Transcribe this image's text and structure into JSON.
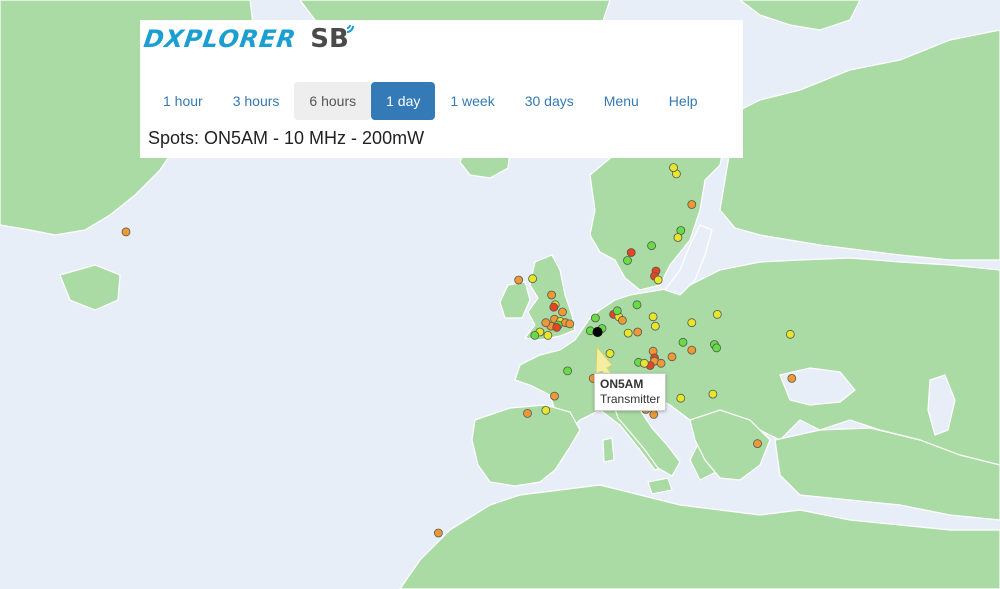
{
  "header": {
    "logo_text": "DXPLORER",
    "logo_mark": "SB",
    "title": "Spots: ON5AM - 10 MHz - 200mW"
  },
  "nav": [
    {
      "label": "1 hour",
      "state": "normal"
    },
    {
      "label": "3 hours",
      "state": "normal"
    },
    {
      "label": "6 hours",
      "state": "highlight"
    },
    {
      "label": "1 day",
      "state": "active"
    },
    {
      "label": "1 week",
      "state": "normal"
    },
    {
      "label": "30 days",
      "state": "normal"
    },
    {
      "label": "Menu",
      "state": "normal"
    },
    {
      "label": "Help",
      "state": "normal"
    }
  ],
  "transmitter": {
    "callsign": "ON5AM",
    "role": "Transmitter",
    "lat": 50.7,
    "lon": 4.6
  },
  "colors": {
    "sea": "#e8eef8",
    "land": "#aadba4",
    "border": "#ffffff",
    "accent": "#337ab7",
    "spot_green": "#66dd44",
    "spot_yellow": "#e6e62a",
    "spot_orange": "#ee9933",
    "spot_red": "#e84422",
    "arrow": "#f4eea0"
  },
  "spots": [
    {
      "lat": 58.6,
      "lon": -60.0,
      "color": "orange"
    },
    {
      "lat": 55.0,
      "lon": -6.2,
      "color": "orange"
    },
    {
      "lat": 55.1,
      "lon": -4.3,
      "color": "yellow"
    },
    {
      "lat": 53.8,
      "lon": -1.7,
      "color": "orange"
    },
    {
      "lat": 53.0,
      "lon": -1.2,
      "color": "yellow"
    },
    {
      "lat": 52.8,
      "lon": -1.4,
      "color": "red"
    },
    {
      "lat": 52.4,
      "lon": -0.2,
      "color": "orange"
    },
    {
      "lat": 51.8,
      "lon": -1.3,
      "color": "orange"
    },
    {
      "lat": 51.6,
      "lon": -0.5,
      "color": "yellow"
    },
    {
      "lat": 51.5,
      "lon": 0.2,
      "color": "orange"
    },
    {
      "lat": 51.3,
      "lon": -0.8,
      "color": "green"
    },
    {
      "lat": 51.2,
      "lon": -1.8,
      "color": "orange"
    },
    {
      "lat": 51.1,
      "lon": -1.0,
      "color": "red"
    },
    {
      "lat": 51.4,
      "lon": 0.8,
      "color": "orange"
    },
    {
      "lat": 50.7,
      "lon": -3.3,
      "color": "yellow"
    },
    {
      "lat": 50.4,
      "lon": -4.0,
      "color": "green"
    },
    {
      "lat": 50.4,
      "lon": -2.2,
      "color": "yellow"
    },
    {
      "lat": 51.5,
      "lon": -2.5,
      "color": "orange"
    },
    {
      "lat": 51.9,
      "lon": 4.3,
      "color": "green"
    },
    {
      "lat": 50.8,
      "lon": 3.6,
      "color": "green"
    },
    {
      "lat": 52.2,
      "lon": 6.8,
      "color": "red"
    },
    {
      "lat": 52.0,
      "lon": 7.5,
      "color": "yellow"
    },
    {
      "lat": 51.7,
      "lon": 8.0,
      "color": "orange"
    },
    {
      "lat": 52.5,
      "lon": 7.3,
      "color": "green"
    },
    {
      "lat": 53.0,
      "lon": 10.0,
      "color": "green"
    },
    {
      "lat": 52.0,
      "lon": 12.2,
      "color": "yellow"
    },
    {
      "lat": 51.2,
      "lon": 12.5,
      "color": "yellow"
    },
    {
      "lat": 51.5,
      "lon": 17.5,
      "color": "yellow"
    },
    {
      "lat": 52.2,
      "lon": 21.0,
      "color": "yellow"
    },
    {
      "lat": 50.7,
      "lon": 10.1,
      "color": "orange"
    },
    {
      "lat": 50.6,
      "lon": 8.8,
      "color": "yellow"
    },
    {
      "lat": 49.6,
      "lon": 20.6,
      "color": "green"
    },
    {
      "lat": 49.3,
      "lon": 20.9,
      "color": "green"
    },
    {
      "lat": 49.8,
      "lon": 16.3,
      "color": "green"
    },
    {
      "lat": 49.1,
      "lon": 17.5,
      "color": "orange"
    },
    {
      "lat": 48.5,
      "lon": 14.8,
      "color": "orange"
    },
    {
      "lat": 49.0,
      "lon": 12.2,
      "color": "orange"
    },
    {
      "lat": 48.4,
      "lon": 12.4,
      "color": "red"
    },
    {
      "lat": 48.1,
      "lon": 12.4,
      "color": "orange"
    },
    {
      "lat": 47.7,
      "lon": 11.8,
      "color": "red"
    },
    {
      "lat": 47.9,
      "lon": 13.3,
      "color": "orange"
    },
    {
      "lat": 48.0,
      "lon": 10.2,
      "color": "green"
    },
    {
      "lat": 47.9,
      "lon": 11.0,
      "color": "yellow"
    },
    {
      "lat": 48.8,
      "lon": 6.3,
      "color": "yellow"
    },
    {
      "lat": 51.0,
      "lon": 5.2,
      "color": "green"
    },
    {
      "lat": 56.5,
      "lon": 8.7,
      "color": "green"
    },
    {
      "lat": 57.1,
      "lon": 9.2,
      "color": "red"
    },
    {
      "lat": 57.6,
      "lon": 12.0,
      "color": "green"
    },
    {
      "lat": 55.7,
      "lon": 12.6,
      "color": "red"
    },
    {
      "lat": 55.3,
      "lon": 12.4,
      "color": "red"
    },
    {
      "lat": 55.0,
      "lon": 12.9,
      "color": "yellow"
    },
    {
      "lat": 58.7,
      "lon": 16.0,
      "color": "green"
    },
    {
      "lat": 58.2,
      "lon": 15.6,
      "color": "yellow"
    },
    {
      "lat": 62.5,
      "lon": 15.4,
      "color": "yellow"
    },
    {
      "lat": 60.5,
      "lon": 17.5,
      "color": "orange"
    },
    {
      "lat": 65.3,
      "lon": 14.5,
      "color": "green"
    },
    {
      "lat": 65.4,
      "lon": 21.2,
      "color": "orange"
    },
    {
      "lat": 62.9,
      "lon": 15.0,
      "color": "yellow"
    },
    {
      "lat": 47.2,
      "lon": 0.5,
      "color": "green"
    },
    {
      "lat": 45.5,
      "lon": 5.3,
      "color": "orange"
    },
    {
      "lat": 46.5,
      "lon": 4.0,
      "color": "orange"
    },
    {
      "lat": 44.8,
      "lon": -1.3,
      "color": "orange"
    },
    {
      "lat": 43.4,
      "lon": -2.5,
      "color": "yellow"
    },
    {
      "lat": 43.1,
      "lon": -5.0,
      "color": "orange"
    },
    {
      "lat": 44.6,
      "lon": 9.3,
      "color": "orange"
    },
    {
      "lat": 43.5,
      "lon": 11.2,
      "color": "orange"
    },
    {
      "lat": 43.0,
      "lon": 12.3,
      "color": "orange"
    },
    {
      "lat": 44.6,
      "lon": 16.0,
      "color": "yellow"
    },
    {
      "lat": 45.0,
      "lon": 20.4,
      "color": "yellow"
    },
    {
      "lat": 40.0,
      "lon": 26.5,
      "color": "orange"
    },
    {
      "lat": 50.5,
      "lon": 31.0,
      "color": "yellow"
    },
    {
      "lat": 46.5,
      "lon": 31.2,
      "color": "orange"
    },
    {
      "lat": 30.0,
      "lon": -17.2,
      "color": "orange"
    }
  ]
}
